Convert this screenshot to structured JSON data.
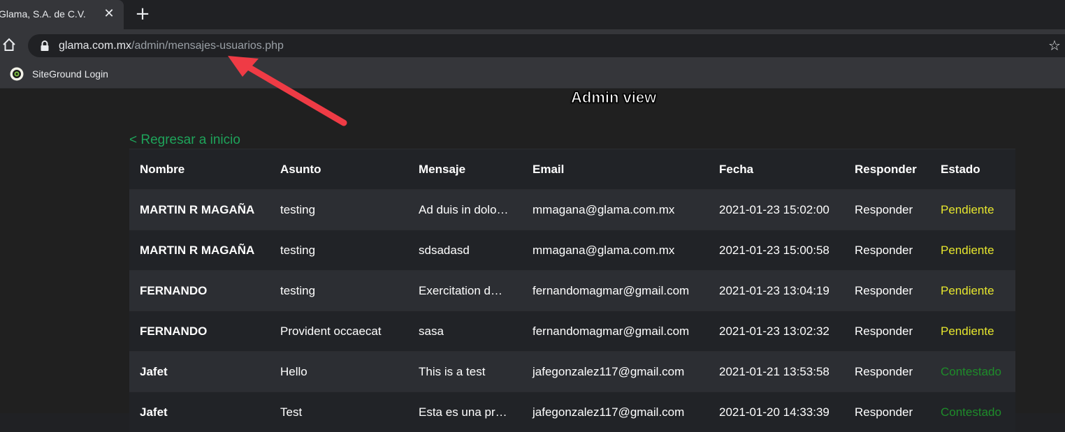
{
  "browser": {
    "tab_title": "Glama, S.A. de C.V.",
    "tab_close_icon": "close-icon",
    "new_tab_glyph": "+",
    "url_host": "glama.com.mx",
    "url_path": "/admin/mensajes-usuarios.php",
    "bookmark_label": "SiteGround Login"
  },
  "annotation": {
    "label": "Admin view",
    "arrow_color": "#ef3b45"
  },
  "page": {
    "back_link": "< Regresar a inicio",
    "colors": {
      "link": "#1ea35a",
      "pendiente": "#e6e62e",
      "contestado": "#1e8c2a"
    }
  },
  "table": {
    "headers": [
      "Nombre",
      "Asunto",
      "Mensaje",
      "Email",
      "Fecha",
      "Responder",
      "Estado"
    ],
    "rows": [
      {
        "nombre": "MARTIN R MAGAÑA",
        "asunto": "testing",
        "mensaje": "Ad duis in dolo…",
        "email": "mmagana@glama.com.mx",
        "fecha": "2021-01-23 15:02:00",
        "responder": "Responder",
        "estado": "Pendiente"
      },
      {
        "nombre": "MARTIN R MAGAÑA",
        "asunto": "testing",
        "mensaje": "sdsadasd",
        "email": "mmagana@glama.com.mx",
        "fecha": "2021-01-23 15:00:58",
        "responder": "Responder",
        "estado": "Pendiente"
      },
      {
        "nombre": "FERNANDO",
        "asunto": "testing",
        "mensaje": "Exercitation d…",
        "email": "fernandomagmar@gmail.com",
        "fecha": "2021-01-23 13:04:19",
        "responder": "Responder",
        "estado": "Pendiente"
      },
      {
        "nombre": "FERNANDO",
        "asunto": "Provident occaecat",
        "mensaje": "sasa",
        "email": "fernandomagmar@gmail.com",
        "fecha": "2021-01-23 13:02:32",
        "responder": "Responder",
        "estado": "Pendiente"
      },
      {
        "nombre": "Jafet",
        "asunto": "Hello",
        "mensaje": "This is a test",
        "email": "jafegonzalez117@gmail.com",
        "fecha": "2021-01-21 13:53:58",
        "responder": "Responder",
        "estado": "Contestado"
      },
      {
        "nombre": "Jafet",
        "asunto": "Test",
        "mensaje": "Esta es una pr…",
        "email": "jafegonzalez117@gmail.com",
        "fecha": "2021-01-20 14:33:39",
        "responder": "Responder",
        "estado": "Contestado"
      }
    ]
  }
}
